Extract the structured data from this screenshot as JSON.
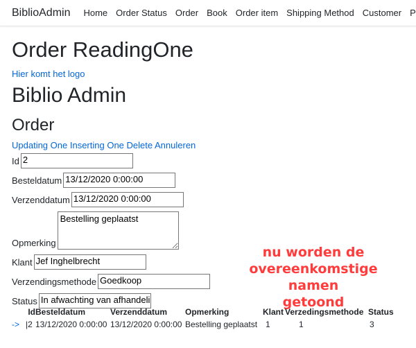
{
  "navbar": {
    "brand": "BiblioAdmin",
    "items": [
      "Home",
      "Order Status",
      "Order",
      "Book",
      "Order item",
      "Shipping Method",
      "Customer",
      "Pri"
    ]
  },
  "page_title": "Order ReadingOne",
  "logo_text": "Hier komt het logo",
  "app_title": "Biblio Admin",
  "section_title": "Order",
  "actions": {
    "updating": "Updating One",
    "inserting": "Inserting One",
    "delete": "Delete",
    "cancel": "Annuleren"
  },
  "form": {
    "id": {
      "label": "Id",
      "value": "2"
    },
    "besteldatum": {
      "label": "Besteldatum",
      "value": "13/12/2020 0:00:00"
    },
    "verzenddatum": {
      "label": "Verzenddatum",
      "value": "13/12/2020 0:00:00"
    },
    "opmerking": {
      "label": "Opmerking",
      "value": "Bestelling geplaatst"
    },
    "klant": {
      "label": "Klant",
      "value": "Jef Inghelbrecht"
    },
    "verzendingsmethode": {
      "label": "Verzendingsmethode",
      "value": "Goedkoop"
    },
    "status": {
      "label": "Status",
      "value": "In afwachting van afhandelin"
    }
  },
  "annotation": {
    "line1": "nu worden de",
    "line2": "overeenkomstige namen",
    "line3": "getoond"
  },
  "table": {
    "headers": [
      "Id",
      "Besteldatum",
      "Verzenddatum",
      "Opmerking",
      "Klant",
      "Verzedingsmethode",
      "Status"
    ],
    "rows": [
      {
        "select": "->",
        "cells": [
          "2",
          "13/12/2020 0:00:00",
          "13/12/2020 0:00:00",
          "Bestelling geplaatst",
          "1",
          "1",
          "3"
        ]
      }
    ]
  },
  "colors": {
    "link": "#0366d6",
    "annotation": "#ff3b3b",
    "text": "#212529"
  }
}
